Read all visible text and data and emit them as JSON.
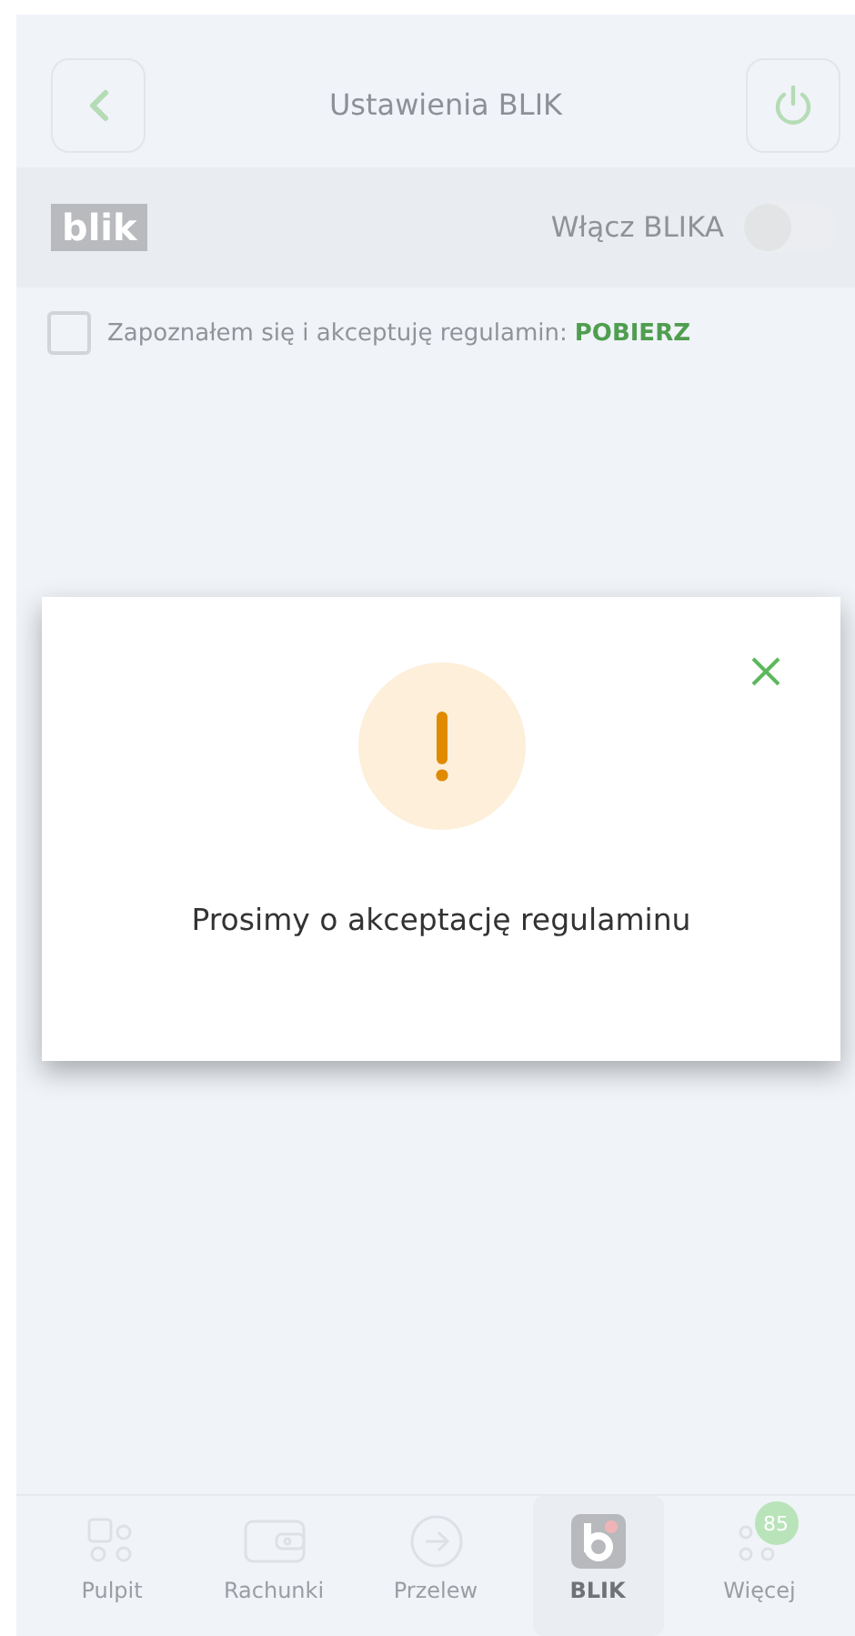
{
  "header": {
    "title": "Ustawienia BLIK"
  },
  "blik_row": {
    "logo": "blik",
    "label": "Włącz BLIKA",
    "on": false
  },
  "terms": {
    "checked": false,
    "text": "Zapoznałem się i akceptuję regulamin:",
    "link": "POBIERZ"
  },
  "dialog": {
    "message": "Prosimy o akceptację regulaminu"
  },
  "nav": [
    {
      "kind": "dashboard",
      "label": "Pulpit",
      "selected": false
    },
    {
      "kind": "wallet",
      "label": "Rachunki",
      "selected": false
    },
    {
      "kind": "transfer",
      "label": "Przelew",
      "selected": false
    },
    {
      "kind": "blik",
      "label": "BLIK",
      "selected": true
    },
    {
      "kind": "more",
      "label": "Więcej",
      "selected": false,
      "badge": "85"
    }
  ]
}
